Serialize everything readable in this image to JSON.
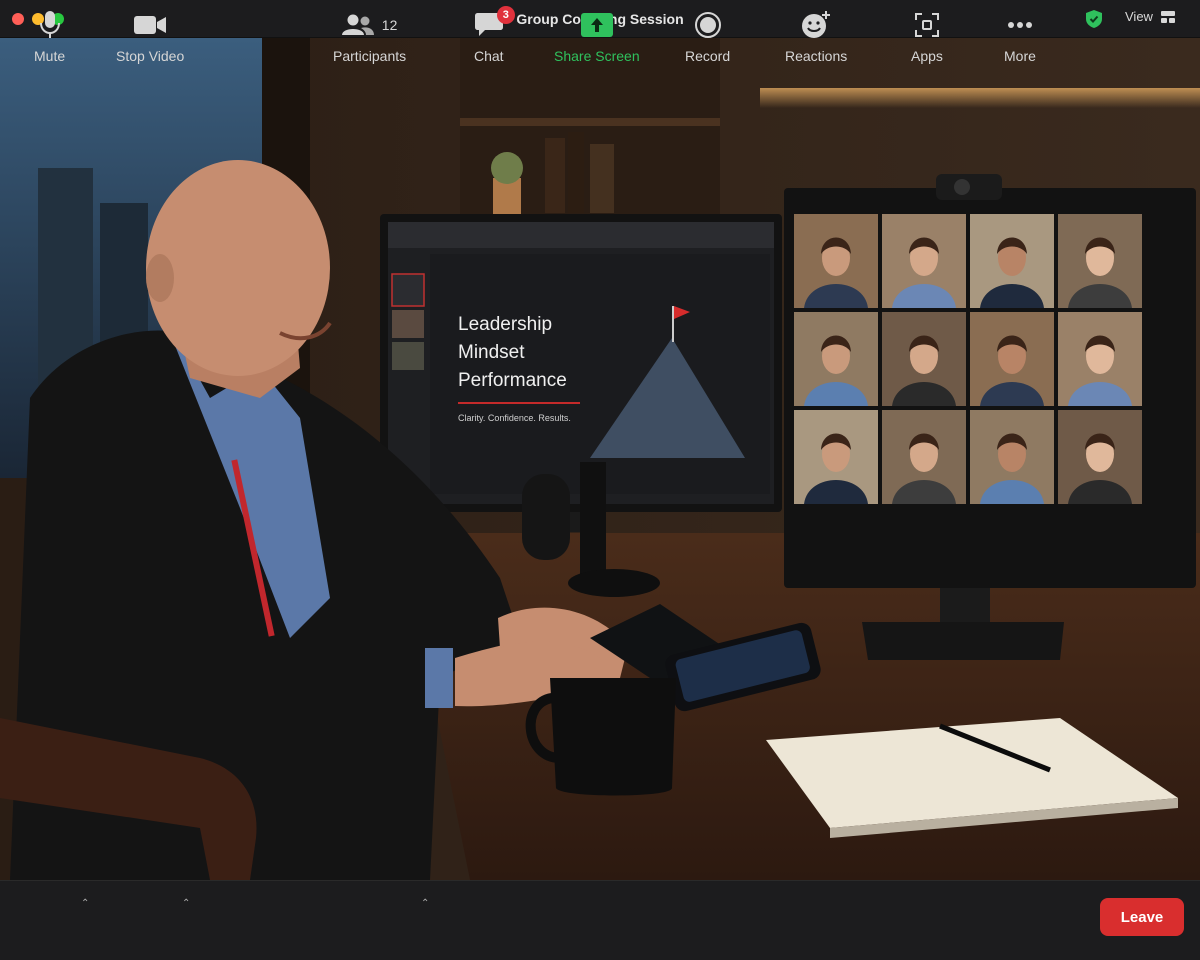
{
  "window": {
    "title": "Group Coaching Session",
    "view_label": "View"
  },
  "slide": {
    "lines": [
      "Leadership",
      "Mindset",
      "Performance"
    ],
    "tagline": "Clarity. Confidence. Results."
  },
  "toolbar": {
    "mute": "Mute",
    "stop_video": "Stop Video",
    "participants": "Participants",
    "participant_count": "12",
    "chat": "Chat",
    "chat_badge": "3",
    "share_screen": "Share Screen",
    "record": "Record",
    "reactions": "Reactions",
    "apps": "Apps",
    "more": "More",
    "leave": "Leave"
  },
  "colors": {
    "leave": "#d92e2e",
    "share_green": "#2fc15d",
    "badge_red": "#e0313c",
    "security_green": "#2fc15d"
  }
}
